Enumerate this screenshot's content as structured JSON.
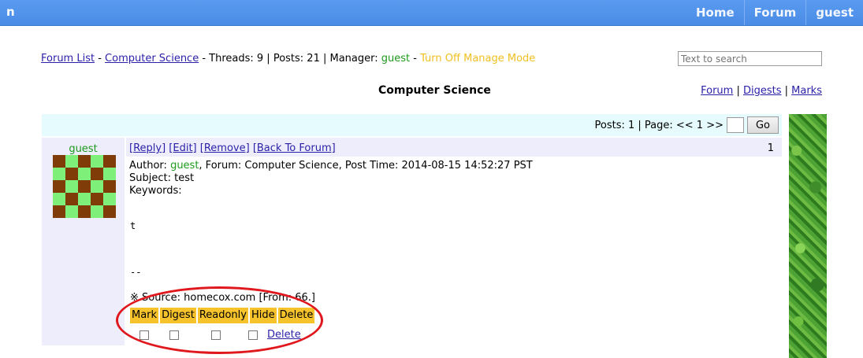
{
  "nav": {
    "logo": "n",
    "items": [
      "Home",
      "Forum",
      "guest"
    ]
  },
  "breadcrumb": {
    "forum_list": "Forum List",
    "sep1": " - ",
    "category": "Computer Science",
    "stats": " - Threads: 9 | Posts: 21 | Manager: ",
    "manager": "guest",
    "sep2": " - ",
    "manage_mode": "Turn Off Manage Mode"
  },
  "search": {
    "placeholder": "Text to search"
  },
  "page_title": "Computer Science",
  "right_links": {
    "forum": "Forum",
    "sep1": " | ",
    "digests": "Digests",
    "sep2": " | ",
    "marks": "Marks"
  },
  "pager": {
    "label": "Posts: 1 | Page: << 1 >>",
    "go": "Go"
  },
  "post": {
    "author": "guest",
    "actions": {
      "reply": "[Reply]",
      "edit": "[Edit]",
      "remove": "[Remove]",
      "back": "[Back To Forum]"
    },
    "number": "1",
    "author_label": "Author: ",
    "author_name": "guest",
    "meta_rest": ", Forum: Computer Science, Post Time: 2014-08-15 14:52:27 PST",
    "subject": "Subject: test",
    "keywords": "Keywords:",
    "body": "t",
    "signature": "--",
    "source": "※ Source: homecox.com  [From: 66.]"
  },
  "manage": {
    "headers": [
      "Mark",
      "Digest",
      "Readonly",
      "Hide",
      "Delete"
    ],
    "delete_link": "Delete"
  },
  "colors": {
    "topbar": "#4a8be6",
    "manager_green": "#1c9a1c",
    "manage_yellow": "#f0c020",
    "header_yellow": "#f7c32c",
    "annotation_red": "#e0181e"
  }
}
